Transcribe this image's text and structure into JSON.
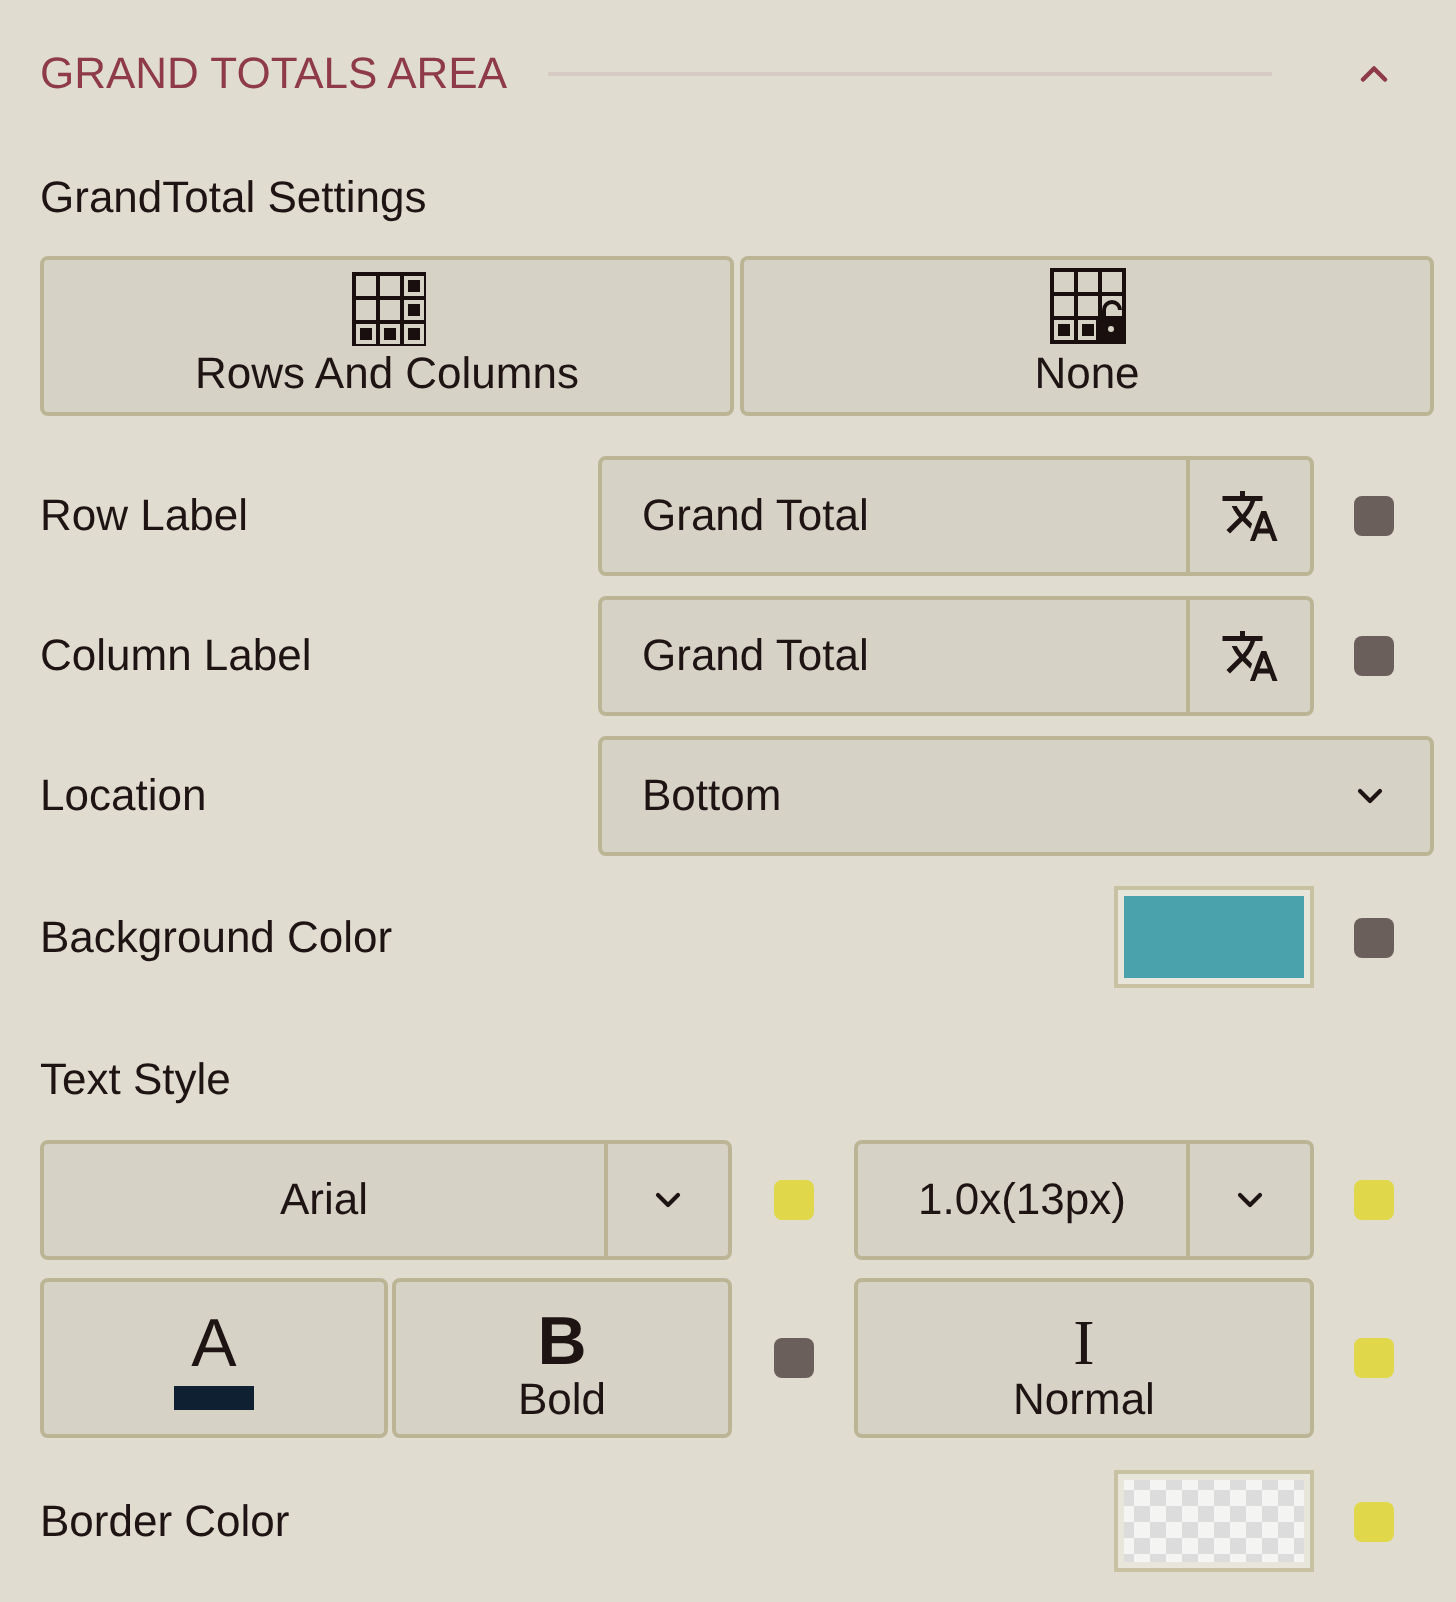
{
  "section": {
    "title": "GRAND TOTALS AREA",
    "expanded": true
  },
  "grand_total_settings": {
    "label": "GrandTotal Settings",
    "options": [
      {
        "kind": "rows-and-columns",
        "label": "Rows And Columns",
        "selected": false
      },
      {
        "kind": "none",
        "label": "None",
        "selected": false
      }
    ]
  },
  "fields": [
    {
      "kind": "text",
      "label": "Row Label",
      "value": "Grand Total",
      "indicator": {
        "color": "#6b5f5b"
      }
    },
    {
      "kind": "text",
      "label": "Column Label",
      "value": "Grand Total",
      "indicator": {
        "color": "#6b5f5b"
      }
    },
    {
      "kind": "select",
      "label": "Location",
      "value": "Bottom"
    },
    {
      "kind": "color",
      "label": "Background Color",
      "color": "#4aa2ac",
      "indicator": {
        "color": "#6b5f5b"
      }
    }
  ],
  "text_style": {
    "label": "Text Style",
    "font": {
      "value": "Arial",
      "indicator": {
        "color": "#e0d84a"
      }
    },
    "size": {
      "value": "1.0x(13px)",
      "indicator": {
        "color": "#e0d84a"
      }
    },
    "font_color": {
      "glyph": "A",
      "color": "#0f2033"
    },
    "weight": {
      "glyph": "B",
      "label": "Bold",
      "indicator": {
        "color": "#6b5f5b"
      }
    },
    "style": {
      "glyph": "I",
      "label": "Normal",
      "indicator": {
        "color": "#e0d84a"
      }
    }
  },
  "border_color": {
    "kind": "color",
    "label": "Border Color",
    "transparent": true,
    "indicator": {
      "color": "#e0d84a"
    }
  }
}
